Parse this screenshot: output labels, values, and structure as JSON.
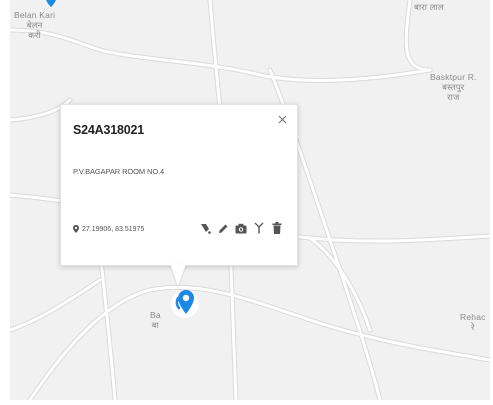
{
  "map": {
    "places": [
      {
        "latin": "Belan Kari",
        "native1": "बेलन",
        "native2": "करी"
      },
      {
        "latin": "",
        "native1": "बारा लाल",
        "native2": ""
      },
      {
        "latin": "Basktpur R.",
        "native1": "बस्तपुर",
        "native2": "राज"
      },
      {
        "latin": "Ba",
        "native1": "बा",
        "native2": ""
      },
      {
        "latin": "Rehac",
        "native1": "रे",
        "native2": ""
      }
    ],
    "colors": {
      "background": "#f1f1f1",
      "road": "#ffffff",
      "road_edge": "#d8d8d8",
      "marker": "#1e88e5"
    }
  },
  "popup": {
    "title": "S24A318021",
    "close_icon": "close-icon",
    "address": "P.V.BAGAPAR ROOM NO.4",
    "coordinates": "27.19906, 83.51975",
    "actions": [
      {
        "name": "route-icon"
      },
      {
        "name": "edit-icon"
      },
      {
        "name": "camera-icon"
      },
      {
        "name": "antenna-icon"
      },
      {
        "name": "delete-icon"
      }
    ]
  }
}
